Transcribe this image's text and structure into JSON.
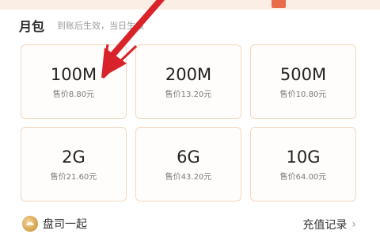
{
  "section": {
    "title": "月包",
    "subtitle": "到账后生效，当日生效"
  },
  "packages": [
    {
      "size": "100M",
      "price": "售价8.80元"
    },
    {
      "size": "200M",
      "price": "售价13.20元"
    },
    {
      "size": "500M",
      "price": "售价10.80元"
    },
    {
      "size": "2G",
      "price": "售价21.60元"
    },
    {
      "size": "6G",
      "price": "售价43.20元"
    },
    {
      "size": "10G",
      "price": "售价64.00元"
    }
  ],
  "footer": {
    "brand": "盘司一起",
    "history_label": "充值记录"
  },
  "annotation": {
    "arrow_color": "#d8232a",
    "arrow_icon": "red-arrow-icon"
  }
}
